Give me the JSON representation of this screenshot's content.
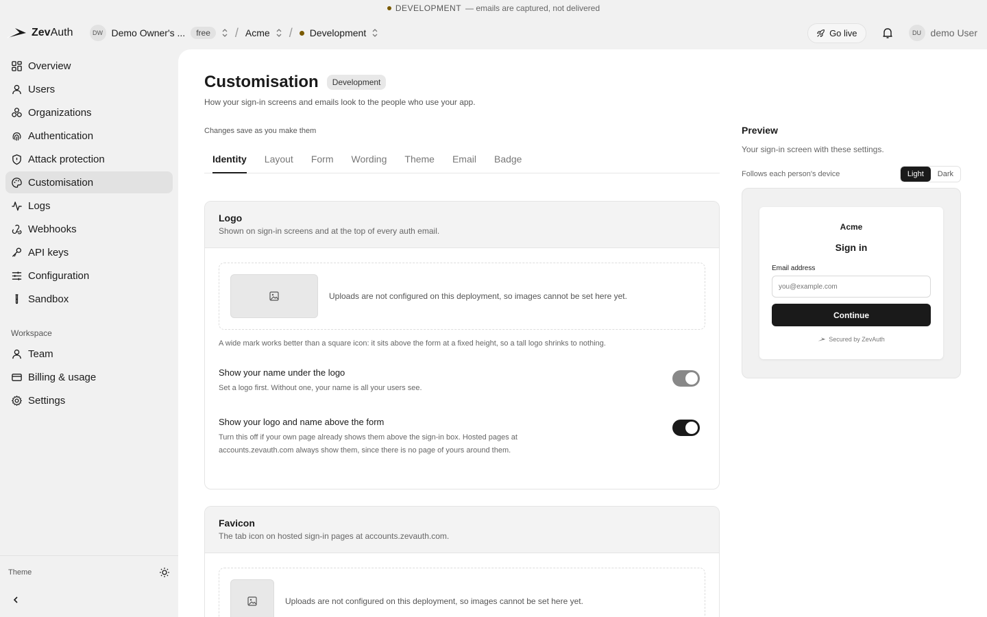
{
  "banner": {
    "env": "DEVELOPMENT",
    "note": "— emails are captured, not delivered"
  },
  "brand": {
    "name_bold": "Zev",
    "name_rest": "Auth"
  },
  "topbar": {
    "owner_initials": "DW",
    "owner_name": "Demo Owner's ...",
    "plan": "free",
    "org": "Acme",
    "environment": "Development",
    "go_live": "Go live",
    "user_initials": "DU",
    "user_name": "demo User"
  },
  "sidebar": {
    "items": [
      {
        "label": "Overview",
        "icon": "grid-icon"
      },
      {
        "label": "Users",
        "icon": "user-icon"
      },
      {
        "label": "Organizations",
        "icon": "organizations-icon"
      },
      {
        "label": "Authentication",
        "icon": "fingerprint-icon"
      },
      {
        "label": "Attack protection",
        "icon": "shield-icon"
      },
      {
        "label": "Customisation",
        "icon": "palette-icon",
        "active": true
      },
      {
        "label": "Logs",
        "icon": "activity-icon"
      },
      {
        "label": "Webhooks",
        "icon": "webhook-icon"
      },
      {
        "label": "API keys",
        "icon": "key-icon"
      },
      {
        "label": "Configuration",
        "icon": "sliders-icon"
      },
      {
        "label": "Sandbox",
        "icon": "test-tube-icon"
      }
    ],
    "workspace_label": "Workspace",
    "workspace_items": [
      {
        "label": "Team",
        "icon": "user-icon"
      },
      {
        "label": "Billing & usage",
        "icon": "credit-card-icon"
      },
      {
        "label": "Settings",
        "icon": "gear-icon"
      }
    ],
    "theme_label": "Theme"
  },
  "page": {
    "title": "Customisation",
    "env_badge": "Development",
    "subtitle": "How your sign-in screens and emails look to the people who use your app.",
    "saves_note": "Changes save as you make them",
    "tabs": [
      "Identity",
      "Layout",
      "Form",
      "Wording",
      "Theme",
      "Email",
      "Badge"
    ],
    "active_tab": "Identity"
  },
  "logo_card": {
    "title": "Logo",
    "desc": "Shown on sign-in screens and at the top of every auth email.",
    "upload_note": "Uploads are not configured on this deployment, so images cannot be set here yet.",
    "hint": "A wide mark works better than a square icon: it sits above the form at a fixed height, so a tall logo shrinks to nothing.",
    "setting1_title": "Show your name under the logo",
    "setting1_desc": "Set a logo first. Without one, your name is all your users see.",
    "setting1_on": true,
    "setting1_disabled": true,
    "setting2_title": "Show your logo and name above the form",
    "setting2_desc": "Turn this off if your own page already shows them above the sign-in box. Hosted pages at accounts.zevauth.com always show them, since there is no page of yours around them.",
    "setting2_on": true
  },
  "favicon_card": {
    "title": "Favicon",
    "desc": "The tab icon on hosted sign-in pages at accounts.zevauth.com.",
    "upload_note": "Uploads are not configured on this deployment, so images cannot be set here yet."
  },
  "preview": {
    "title": "Preview",
    "desc": "Your sign-in screen with these settings.",
    "follow_note": "Follows each person's device",
    "mode_light": "Light",
    "mode_dark": "Dark",
    "selected_mode": "Light",
    "org_name": "Acme",
    "heading": "Sign in",
    "email_label": "Email address",
    "email_placeholder": "you@example.com",
    "continue": "Continue",
    "secured": "Secured by ZevAuth"
  }
}
